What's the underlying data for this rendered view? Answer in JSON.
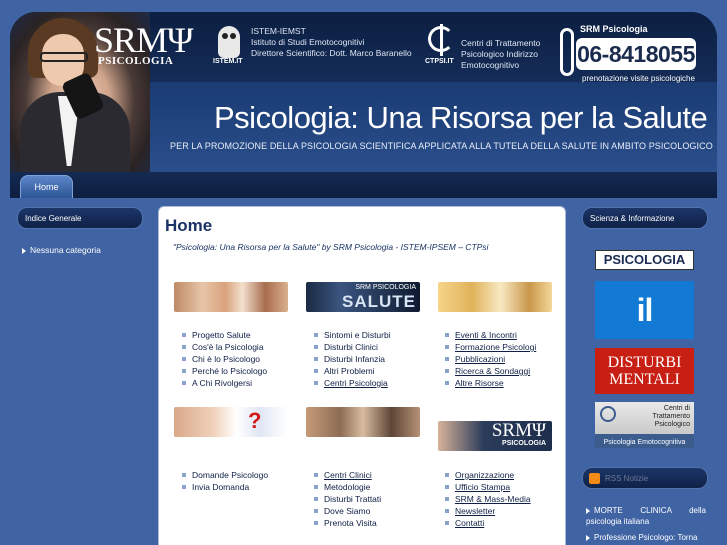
{
  "header": {
    "logo_big": "SRMΨ",
    "logo_small": "PSICOLOGIA",
    "istem_logo_label": "ISTEM.IT",
    "istem_lines": [
      "ISTEM-IEMST",
      "Istituto di Studi Emotocognitivi",
      "Direttore Scientifico: Dott. Marco Baranello"
    ],
    "ctpsi_logo_label": "CTPSI.IT",
    "ctpsi_lines": [
      "Centri di Trattamento",
      "Psicologico Indirizzo",
      "Emotocognitivo"
    ],
    "phone_label": "SRM Psicologia",
    "phone_number": "06-8418055",
    "phone_caption": "prenotazione visite psicologiche",
    "title": "Psicologia: Una Risorsa per la Salute",
    "subtitle": "PER LA PROMOZIONE DELLA PSICOLOGIA SCIENTIFICA APPLICATA ALLA TUTELA DELLA SALUTE IN AMBITO PSICOLOGICO"
  },
  "nav": {
    "tabs": [
      {
        "label": "Home"
      }
    ]
  },
  "left_sidebar": {
    "heading": "Indice Generale",
    "items": [
      {
        "label": "Nessuna categoria"
      }
    ]
  },
  "right_sidebar": {
    "heading": "Scienza & Informazione",
    "ads": {
      "psicologia": "PSICOLOGIA",
      "potere": "il potere",
      "disturbi_1": "DISTURBI",
      "disturbi_2": "MENTALI",
      "ctp_1": "Centri di",
      "ctp_2": "Trattamento",
      "ctp_3": "Psicologico",
      "ctp_bottom": "Psicologia Emotocognitiva"
    },
    "rss_heading": "RSS Notizie",
    "news": [
      {
        "label": "MORTE CLINICA della psicologia italiana"
      },
      {
        "label": "Professione Psicologo: Torna"
      }
    ]
  },
  "main": {
    "title": "Home",
    "tagline": "\"Psicologia: Una Risorsa per la Salute\" by SRM Psicologia - ISTEM-IPSEM – CTPsi",
    "banner_b_small": "SRM PSICOLOGIA",
    "banner_b_big": "SALUTE",
    "banner_f_big": "SRMΨ",
    "banner_f_small": "PSICOLOGIA",
    "columns": [
      {
        "items": [
          "Progetto Salute",
          "Cos'è la Psicologia",
          "Chi è lo Psicologo",
          "Perché lo Psicologo",
          "A Chi Rivolgersi"
        ]
      },
      {
        "items": [
          "Sintomi e Disturbi",
          "Disturbi Clinici",
          "Disturbi Infanzia",
          "Altri Problemi",
          "Centri Psicologia"
        ]
      },
      {
        "items": [
          "Eventi & Incontri",
          "Formazione Psicologi",
          "Pubblicazioni",
          "Ricerca & Sondaggi",
          "Altre Risorse"
        ]
      },
      {
        "items": [
          "Domande Psicologo",
          "Invia Domanda"
        ]
      },
      {
        "items": [
          "Centri Clinici",
          "Metodologie",
          "Disturbi Trattati",
          "Dove Siamo",
          "Prenota Visita"
        ]
      },
      {
        "items": [
          "Organizzazione",
          "Ufficio Stampa",
          "SRM & Mass-Media",
          "Newsletter",
          "Contatti"
        ]
      }
    ]
  },
  "colors": {
    "background": "#3f63a3",
    "header_dark": "#14305e",
    "accent_blue": "#1279d4",
    "accent_red": "#c81f14",
    "link": "#0f1f45"
  }
}
